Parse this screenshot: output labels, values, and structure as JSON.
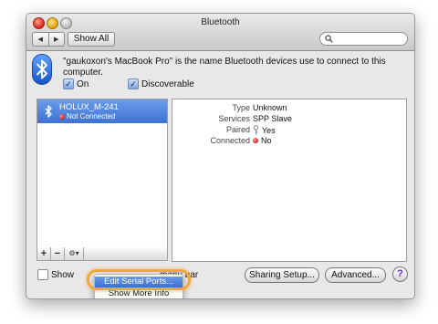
{
  "window": {
    "title": "Bluetooth"
  },
  "toolbar": {
    "back_glyph": "◀",
    "forward_glyph": "▶",
    "show_all_label": "Show All",
    "search_placeholder": ""
  },
  "header": {
    "message": "\"gaukoxon's MacBook Pro\" is the name Bluetooth devices use to connect to this computer.",
    "on_label": "On",
    "on_checked": true,
    "discoverable_label": "Discoverable",
    "discoverable_checked": true
  },
  "device_list": {
    "devices": [
      {
        "name": "HOLUX_M-241",
        "status": "Not Connected",
        "selected": true
      }
    ],
    "add_label": "+",
    "remove_label": "−",
    "gear_label": "⚙▾"
  },
  "device_info": {
    "rows": [
      {
        "label": "Type",
        "value": "Unknown"
      },
      {
        "label": "Services",
        "value": "SPP Slave"
      },
      {
        "label": "Paired",
        "value": "Yes"
      },
      {
        "label": "Connected",
        "value": "No"
      }
    ]
  },
  "bottom": {
    "show_label": "Show",
    "menubar_label": "menu bar",
    "sharing_setup_label": "Sharing Setup...",
    "advanced_label": "Advanced...",
    "help_label": "?"
  },
  "gear_menu": {
    "items": [
      "Edit Serial Ports...",
      "Show More Info"
    ],
    "selected": "Edit Serial Ports..."
  },
  "colors": {
    "selection": "#3e73d3",
    "highlight_ring": "#f2a53a",
    "status_red": "#d21d1d"
  },
  "icons": [
    "bluetooth-icon",
    "search-icon",
    "gear-icon",
    "status-dot-icon",
    "key-icon",
    "help-icon"
  ]
}
